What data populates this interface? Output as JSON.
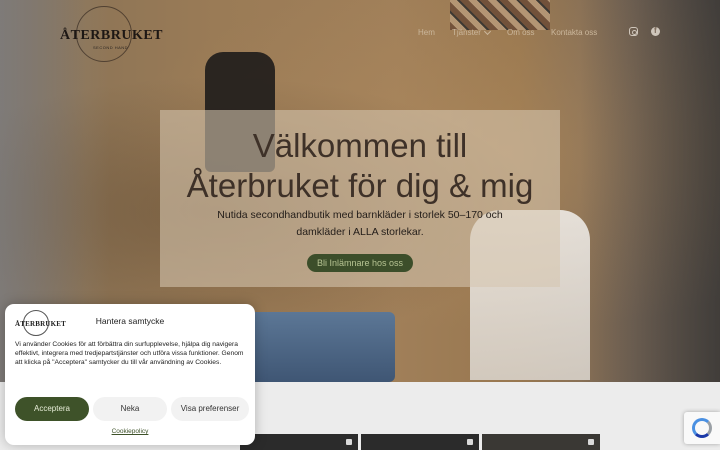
{
  "header": {
    "logo_text": "ÅTERBRUKET",
    "logo_subtext": "SECOND HAND",
    "nav": [
      {
        "label": "Hem"
      },
      {
        "label": "Tjänster"
      },
      {
        "label": "Om oss"
      },
      {
        "label": "Kontakta oss"
      }
    ],
    "social_icons": [
      "instagram-icon",
      "facebook-icon"
    ]
  },
  "hero": {
    "title_line1": "Välkommen till",
    "title_line2": "Återbruket för dig & mig",
    "subtitle_line1": "Nutida secondhandbutik med barnkläder i storlek 50–170 och",
    "subtitle_line2": "damkläder i ALLA storlekar.",
    "button_label": "Bli Inlämnare hos oss"
  },
  "cookie_dialog": {
    "logo_text": "ÅTERBRUKET",
    "title": "Hantera samtycke",
    "body": "Vi använder Cookies för att förbättra din surfupplevelse, hjälpa dig navigera effektivt, integrera med tredjepartstjänster och utföra vissa funktioner. Genom att klicka på \"Acceptera\" samtycker du till vår användning av Cookies.",
    "accept_label": "Acceptera",
    "deny_label": "Neka",
    "prefs_label": "Visa preferenser",
    "policy_link": "Cookiepolicy"
  },
  "colors": {
    "accent_green": "#3e5229",
    "nav_text": "#cbb79c",
    "title_text": "#3e3128"
  }
}
